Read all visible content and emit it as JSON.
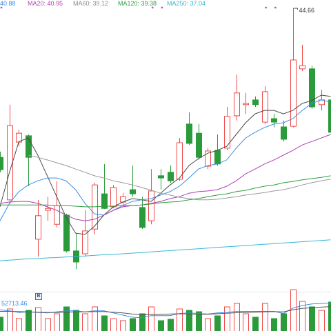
{
  "legend": [
    {
      "text": "40.88",
      "color": "#3a8ee6"
    },
    {
      "text": "MA20: 40.95",
      "color": "#b03fb5"
    },
    {
      "text": "MA60: 39.12",
      "color": "#8c8c8c"
    },
    {
      "text": "MA120: 39.38",
      "color": "#2e9e3e"
    },
    {
      "text": "MA250: 37.04",
      "color": "#35b8d6"
    }
  ],
  "volume_panel": {
    "value_text": "52713.46",
    "value_color": "#3a8ee6",
    "marker_text": "B"
  },
  "colors": {
    "up": "#f04848",
    "down": "#2a9a3a",
    "background": "#ffffff",
    "event_marker": "#d63fd0",
    "separator": "#e4e4e4"
  },
  "chart_data": {
    "type": "bar",
    "bar_style": "candlestick",
    "grid": false,
    "legend": "top-left",
    "ylim": [
      35.79,
      44.92
    ],
    "candles": [
      {
        "o": 39.96,
        "h": 40.14,
        "l": 39.49,
        "c": 39.57
      },
      {
        "o": 38.62,
        "h": 41.62,
        "l": 38.49,
        "c": 40.96
      },
      {
        "o": 40.44,
        "h": 40.83,
        "l": 40.31,
        "c": 40.72
      },
      {
        "o": 40.64,
        "h": 40.68,
        "l": 39.05,
        "c": 39.96
      },
      {
        "o": 37.38,
        "h": 38.62,
        "l": 36.83,
        "c": 38.12
      },
      {
        "o": 38.29,
        "h": 38.72,
        "l": 37.96,
        "c": 38.35
      },
      {
        "o": 37.85,
        "h": 39.2,
        "l": 37.75,
        "c": 38.44
      },
      {
        "o": 38.14,
        "h": 38.18,
        "l": 36.96,
        "c": 37.01
      },
      {
        "o": 37.01,
        "h": 37.57,
        "l": 36.44,
        "c": 36.66
      },
      {
        "o": 36.92,
        "h": 38.29,
        "l": 36.83,
        "c": 37.64
      },
      {
        "o": 37.7,
        "h": 39.16,
        "l": 37.53,
        "c": 39.09
      },
      {
        "o": 38.81,
        "h": 39.75,
        "l": 38.33,
        "c": 38.35
      },
      {
        "o": 38.4,
        "h": 39.09,
        "l": 38.35,
        "c": 39.01
      },
      {
        "o": 38.55,
        "h": 38.83,
        "l": 38.4,
        "c": 38.72
      },
      {
        "o": 38.94,
        "h": 39.7,
        "l": 38.72,
        "c": 38.81
      },
      {
        "o": 38.38,
        "h": 38.72,
        "l": 37.7,
        "c": 37.75
      },
      {
        "o": 37.96,
        "h": 39.59,
        "l": 37.85,
        "c": 38.9
      },
      {
        "o": 39.38,
        "h": 39.59,
        "l": 38.94,
        "c": 39.31
      },
      {
        "o": 39.49,
        "h": 39.7,
        "l": 39.16,
        "c": 39.22
      },
      {
        "o": 39.27,
        "h": 40.57,
        "l": 39.22,
        "c": 40.42
      },
      {
        "o": 41.01,
        "h": 41.38,
        "l": 40.35,
        "c": 40.4
      },
      {
        "o": 40.72,
        "h": 41.01,
        "l": 39.88,
        "c": 39.96
      },
      {
        "o": 39.68,
        "h": 40.25,
        "l": 39.59,
        "c": 40.16
      },
      {
        "o": 40.18,
        "h": 40.68,
        "l": 39.7,
        "c": 39.75
      },
      {
        "o": 40.25,
        "h": 41.55,
        "l": 40.18,
        "c": 41.25
      },
      {
        "o": 41.27,
        "h": 42.57,
        "l": 41.12,
        "c": 41.99
      },
      {
        "o": 41.62,
        "h": 41.99,
        "l": 41.33,
        "c": 41.66
      },
      {
        "o": 41.77,
        "h": 41.88,
        "l": 41.55,
        "c": 41.62
      },
      {
        "o": 41.07,
        "h": 42.2,
        "l": 41.01,
        "c": 42.03
      },
      {
        "o": 41.18,
        "h": 41.33,
        "l": 40.9,
        "c": 41.07
      },
      {
        "o": 40.92,
        "h": 41.12,
        "l": 40.46,
        "c": 40.53
      },
      {
        "o": 40.94,
        "h": 44.66,
        "l": 40.9,
        "c": 43.03
      },
      {
        "o": 42.75,
        "h": 43.51,
        "l": 42.68,
        "c": 42.85
      },
      {
        "o": 42.75,
        "h": 42.85,
        "l": 41.49,
        "c": 41.55
      },
      {
        "o": 41.62,
        "h": 42.09,
        "l": 41.44,
        "c": 41.77
      },
      {
        "o": 41.77,
        "h": 41.88,
        "l": 40.68,
        "c": 40.75
      }
    ],
    "series": [
      {
        "color": "#4a4a4a",
        "values": [
          38.4,
          39.49,
          40.46,
          40.57,
          40.03,
          39.38,
          38.72,
          38.07,
          37.57,
          37.53,
          37.79,
          38.14,
          38.4,
          38.55,
          38.66,
          38.62,
          38.57,
          38.83,
          39.09,
          39.31,
          39.7,
          39.92,
          40.09,
          40.18,
          40.31,
          40.68,
          41.05,
          41.33,
          41.44,
          41.44,
          41.33,
          41.44,
          41.66,
          41.75,
          41.92,
          41.88
        ]
      },
      {
        "color": "#3a8ee6",
        "values": [
          37.96,
          38.51,
          38.88,
          39.09,
          39.22,
          39.31,
          39.31,
          39.22,
          38.94,
          38.51,
          38.18,
          38.14,
          38.29,
          38.44,
          38.57,
          38.62,
          38.66,
          38.77,
          38.88,
          39.05,
          39.31,
          39.59,
          39.7,
          39.75,
          39.88,
          40.25,
          40.57,
          40.75,
          40.9,
          41.01,
          41.05,
          41.18,
          41.44,
          41.66,
          41.77,
          41.7
        ]
      },
      {
        "name": "MA20",
        "color": "#b03fb5",
        "values": [
          38.51,
          38.55,
          38.57,
          38.57,
          38.51,
          38.4,
          38.29,
          38.14,
          38.01,
          37.96,
          38.01,
          38.14,
          38.29,
          38.4,
          38.44,
          38.46,
          38.51,
          38.57,
          38.66,
          38.72,
          38.83,
          38.88,
          38.9,
          38.94,
          39.05,
          39.22,
          39.44,
          39.59,
          39.75,
          39.88,
          40.03,
          40.18,
          40.35,
          40.46,
          40.57,
          40.68
        ]
      },
      {
        "name": "MA60",
        "color": "#9a9a9a",
        "values": [
          null,
          null,
          null,
          40.03,
          39.96,
          39.88,
          39.79,
          39.7,
          39.59,
          39.49,
          39.38,
          39.31,
          39.22,
          39.16,
          39.09,
          39.01,
          38.92,
          38.83,
          38.77,
          38.7,
          38.66,
          38.62,
          38.62,
          38.64,
          38.68,
          38.72,
          38.77,
          38.81,
          38.85,
          38.9,
          38.94,
          39.01,
          39.09,
          39.16,
          39.22,
          39.27
        ]
      },
      {
        "name": "MA120",
        "color": "#2e9e3e",
        "values": [
          38.46,
          38.46,
          38.46,
          38.46,
          38.46,
          38.46,
          38.44,
          38.44,
          38.42,
          38.4,
          38.4,
          38.42,
          38.42,
          38.44,
          38.44,
          38.46,
          38.49,
          38.53,
          38.55,
          38.57,
          38.62,
          38.66,
          38.72,
          38.77,
          38.81,
          38.88,
          38.92,
          38.99,
          39.05,
          39.09,
          39.16,
          39.2,
          39.25,
          39.29,
          39.33,
          39.38
        ]
      },
      {
        "name": "MA250",
        "color": "#35b8d6",
        "values": [
          36.7,
          36.72,
          36.74,
          36.76,
          36.77,
          36.79,
          36.8,
          36.82,
          36.84,
          36.85,
          36.87,
          36.89,
          36.9,
          36.92,
          36.94,
          36.96,
          36.98,
          37.0,
          37.02,
          37.04,
          37.06,
          37.08,
          37.1,
          37.12,
          37.14,
          37.16,
          37.18,
          37.2,
          37.22,
          37.24,
          37.26,
          37.28,
          37.3,
          37.32,
          37.34,
          37.36
        ]
      }
    ],
    "max_marker": {
      "index": 31,
      "label": "44.66"
    },
    "event_markers": [
      0,
      16,
      17,
      28,
      29
    ],
    "volume": {
      "ylim": [
        0,
        80600
      ],
      "values": [
        26000,
        41600,
        23400,
        39000,
        44200,
        23400,
        32500,
        45500,
        39000,
        32500,
        45500,
        28600,
        23400,
        19500,
        23400,
        32500,
        45500,
        19500,
        22100,
        41600,
        39000,
        36400,
        23400,
        28600,
        45500,
        52000,
        32500,
        26000,
        52000,
        23400,
        32500,
        78000,
        55900,
        45500,
        39000,
        54600
      ],
      "ma": [
        {
          "color": "#3a8ee6",
          "values": [
            40000,
            38000,
            35000,
            36000,
            35000,
            34000,
            36000,
            38000,
            38000,
            36000,
            38000,
            38000,
            34000,
            30000,
            26000,
            25000,
            29000,
            29000,
            29000,
            33000,
            34000,
            33000,
            32000,
            34000,
            35000,
            37000,
            37000,
            37000,
            37000,
            37000,
            33000,
            43000,
            48000,
            51000,
            52000,
            52713.46
          ]
        },
        {
          "color": "#555555",
          "values": [
            37000,
            37000,
            36500,
            36000,
            35500,
            35000,
            35000,
            35500,
            36000,
            36000,
            36500,
            36500,
            35500,
            34000,
            32000,
            31000,
            31000,
            31500,
            32000,
            32500,
            32000,
            31500,
            31500,
            32500,
            33500,
            34500,
            35000,
            35500,
            36000,
            36500,
            36000,
            40000,
            42500,
            44000,
            45000,
            46000
          ]
        }
      ]
    }
  }
}
